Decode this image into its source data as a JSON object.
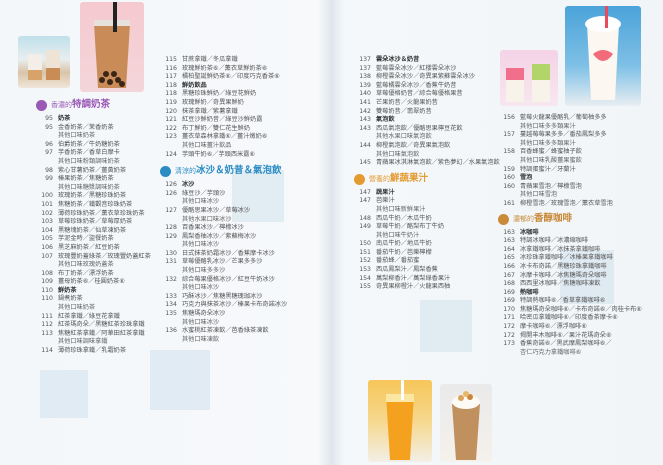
{
  "colors": {
    "tea": "#9b59b6",
    "ice": "#2b8cc4",
    "juice": "#e39a2f",
    "coffee": "#c98a3a"
  },
  "sections": {
    "tea": {
      "pre": "香濃的",
      "big": "特調奶茶"
    },
    "ice": {
      "pre": "清涼的",
      "big": "冰沙＆奶昔＆氣泡飲"
    },
    "juice": {
      "pre": "營養的",
      "big": "鮮蔬果汁"
    },
    "coffee": {
      "pre": "濃郁的",
      "big": "香醇咖啡"
    }
  },
  "col1": [
    [
      "95",
      "奶茶",
      "cat"
    ],
    [
      "95",
      "金香奶茶／茉香奶茶",
      ""
    ],
    [
      "",
      "其他口味奶茶",
      "sub"
    ],
    [
      "96",
      "伯爵奶茶／牛奶糖奶茶",
      ""
    ],
    [
      "97",
      "芋香奶茶／香草白摩卡",
      ""
    ],
    [
      "",
      "其他口味粉類調味奶茶",
      "sub"
    ],
    [
      "98",
      "紫心甘薯奶茶／薑黃奶茶",
      ""
    ],
    [
      "99",
      "榛果奶茶／焦糖奶茶",
      ""
    ],
    [
      "",
      "其他口味糖漿調味奶茶",
      "sub"
    ],
    [
      "100",
      "玫瑰奶茶／黑糖珍珠奶茶",
      ""
    ],
    [
      "101",
      "焦糖奶茶／鐵觀音珍珠奶茶",
      ""
    ],
    [
      "102",
      "薄荷珍珠奶茶／薰衣草珍珠奶茶",
      ""
    ],
    [
      "103",
      "草莓珍珠奶茶／草莓厚奶茶",
      ""
    ],
    [
      "104",
      "黑糖塊奶茶／仙草凍奶茶",
      ""
    ],
    [
      "105",
      "芋泥金時／盜餐奶茶",
      ""
    ],
    [
      "106",
      "黑芝麻奶茶／紅豆奶茶",
      ""
    ],
    [
      "107",
      "玫瑰豐奶蓋綠茶／玫瑰豐奶蓋紅茶",
      ""
    ],
    [
      "",
      "其他口味玫瑰奶蓋茶",
      "sub"
    ],
    [
      "108",
      "布丁奶茶／漂浮奶茶",
      ""
    ],
    [
      "109",
      "薑母奶茶⑥／桂圓奶茶⑥",
      ""
    ],
    [
      "110",
      "鮮奶茶",
      "cat"
    ],
    [
      "110",
      "鍋煮奶茶",
      ""
    ],
    [
      "",
      "其他口味奶茶",
      "sub"
    ],
    [
      "111",
      "紅茶拿鐵／綠豆花拿鐵",
      ""
    ],
    [
      "112",
      "紅茶瑪奇朵／黑糖紅茶珍珠拿鐵",
      ""
    ],
    [
      "113",
      "焦糖紅茶拿鐵／阿華田紅茶拿鐵",
      ""
    ],
    [
      "",
      "其他口味調味拿鐵",
      "sub"
    ],
    [
      "114",
      "薄荷珍珠拿鐵／乳霜奶茶",
      ""
    ]
  ],
  "col2": [
    [
      "115",
      "甘蔗拿鐵／冬瓜拿鐵",
      ""
    ],
    [
      "116",
      "玫瑰鮮奶茶⑥／薰衣草鮮奶茶⑥",
      ""
    ],
    [
      "117",
      "橘柏聖誕鮮奶茶⑥／印度巧克香茶⑥",
      ""
    ],
    [
      "118",
      "鮮奶飲品",
      "cat"
    ],
    [
      "118",
      "黑糖珍珠鮮奶／綠豆花鮮奶",
      ""
    ],
    [
      "119",
      "玫瑰鮮奶／奇異果鮮奶",
      ""
    ],
    [
      "120",
      "抹茶拿鐵／紫薯拿鐵",
      ""
    ],
    [
      "121",
      "紅豆沙鮮奶昔／綠豆沙鮮奶露",
      ""
    ],
    [
      "122",
      "布丁鮮奶／雙仁花生鮮奶",
      ""
    ],
    [
      "123",
      "薑衣草森林拿鐵⑥／薑汁燉奶⑥",
      ""
    ],
    [
      "",
      "其他口味薑汁飲品",
      "sub"
    ],
    [
      "124",
      "芋頭牛奶⑥／芋頭西米露⑥",
      ""
    ]
  ],
  "col2b": [
    [
      "126",
      "冰沙",
      "cat"
    ],
    [
      "126",
      "綠豆沙／芋頭沙",
      ""
    ],
    [
      "",
      "其他口味冰沙",
      "sub"
    ],
    [
      "127",
      "優酪思果冰沙／草莓冰沙",
      ""
    ],
    [
      "",
      "其他水果口味冰沙",
      "sub"
    ],
    [
      "128",
      "百香果冰沙／檸檬冰沙",
      ""
    ],
    [
      "129",
      "鳳梨香柚冰沙／紫蘇梅冰沙",
      ""
    ],
    [
      "",
      "其他口味冰沙",
      "sub"
    ],
    [
      "130",
      "日式抹茶奶霜冰沙／香蕉摩卡冰沙",
      ""
    ],
    [
      "131",
      "草莓優酪乳冰沙／芒果多多沙",
      ""
    ],
    [
      "",
      "其他口味多多沙",
      "sub"
    ],
    [
      "132",
      "綜合莓果優格冰沙／紅豆牛奶冰沙",
      ""
    ],
    [
      "",
      "其他口味冰沙",
      "sub"
    ],
    [
      "133",
      "巧酥冰沙／焦糖黑糖瑰珈冰沙",
      ""
    ],
    [
      "134",
      "巧克力與抹茶冰沙／榛果卡布奇諾冰沙",
      ""
    ],
    [
      "135",
      "焦糖瑪奇朵冰沙",
      ""
    ],
    [
      "",
      "其他口味冰沙",
      "sub"
    ],
    [
      "136",
      "水蜜桃紅茶凍飲／芭香綠茶凍飲",
      ""
    ],
    [
      "",
      "其他口味凍飲",
      "sub"
    ]
  ],
  "col3": [
    [
      "137",
      "雲朵冰沙＆奶昔",
      "cat"
    ],
    [
      "137",
      "藍莓雲朵冰沙／紅櫻雲朵冰沙",
      ""
    ],
    [
      "138",
      "柳橙雲朵冰沙／奇異果紫蘇雲朵冰沙",
      ""
    ],
    [
      "139",
      "藍莓橘雲朵冰沙／香蕉牛奶昔",
      ""
    ],
    [
      "140",
      "草莓優格奶昔／綜合莓優格果昔",
      ""
    ],
    [
      "141",
      "芒果奶昔／火龍果奶昔",
      ""
    ],
    [
      "142",
      "雙莓奶昔／翡翠奶昔",
      ""
    ],
    [
      "143",
      "氣泡飲",
      "cat"
    ],
    [
      "143",
      "西瓜氣泡飲／優酪思果檸豆花飲",
      ""
    ],
    [
      "",
      "其他水果口味氣泡飲",
      "sub"
    ],
    [
      "144",
      "柳橙氣泡飲／奇異果氣泡飲",
      ""
    ],
    [
      "",
      "其他口味氣泡飲",
      "sub"
    ],
    [
      "145",
      "青蘋果冰淇淋氣泡飲／紫色夢幻／水果氣泡飲",
      ""
    ]
  ],
  "col3b": [
    [
      "147",
      "蔬果汁",
      "cat"
    ],
    [
      "147",
      "芭樂汁",
      ""
    ],
    [
      "",
      "其他口味新鮮果汁",
      "sub"
    ],
    [
      "148",
      "西瓜牛奶／木瓜牛奶",
      ""
    ],
    [
      "149",
      "草莓牛奶／酪梨布丁牛奶",
      ""
    ],
    [
      "",
      "其他口味牛奶汁",
      "sub"
    ],
    [
      "150",
      "南瓜牛奶／地瓜牛奶",
      ""
    ],
    [
      "151",
      "番茄牛奶／芭樂檸檬",
      ""
    ],
    [
      "152",
      "番茄蜂／番茄蜜",
      ""
    ],
    [
      "153",
      "西瓜鳳梨汁／鳳梨香蕉",
      ""
    ],
    [
      "154",
      "萬梨柳香汁／萬梨綠香果汁",
      ""
    ],
    [
      "155",
      "奇異果柳橙汁／火龍果西柚",
      ""
    ]
  ],
  "col4": [
    [
      "156",
      "藍莓火龍果優酪乳／葡萄柚多多",
      ""
    ],
    [
      "",
      "其他口味多多類果汁",
      "sub"
    ],
    [
      "157",
      "蔓越莓莓果多多／番茄鳳梨多多",
      ""
    ],
    [
      "",
      "其他口味多多類果汁",
      "sub"
    ],
    [
      "158",
      "百香蜂蜜／蜂蜜柚子飲",
      ""
    ],
    [
      "",
      "其他口味乳酸薑果蜜飲",
      "sub"
    ],
    [
      "159",
      "特調蛋蜜汁／牙蘭汁",
      ""
    ],
    [
      "160",
      "雪泡",
      "cat"
    ],
    [
      "160",
      "青蘋果雪泡／檸檬雪泡",
      ""
    ],
    [
      "",
      "其他口味雪泡",
      "sub"
    ],
    [
      "161",
      "柳橙雪泡／玫瑰雪泡／薰衣草雪泡",
      ""
    ]
  ],
  "col4b": [
    [
      "163",
      "冰咖啡",
      "cat"
    ],
    [
      "163",
      "特調冰咖啡／冰濃縮咖啡",
      ""
    ],
    [
      "164",
      "冰拿鐵咖啡／冰抹茶拿鐵咖啡",
      ""
    ],
    [
      "165",
      "冰珍珠拿鐵咖啡／冰榛果拿鐵咖啡",
      ""
    ],
    [
      "166",
      "冰卡布奇諾／黑糖珍珠拿鐵咖啡",
      ""
    ],
    [
      "167",
      "冰摩卡咖啡／冰焦糖瑪奇朵咖啡",
      ""
    ],
    [
      "168",
      "西西里冰咖啡／焦糖咖啡凍飲",
      ""
    ],
    [
      "169",
      "熱咖啡",
      "cat"
    ],
    [
      "169",
      "特調熱咖啡⑥／香草拿鐵咖啡⑥",
      ""
    ],
    [
      "170",
      "焦糖瑪奇朵咖啡⑥／卡布奇諾⑥／肉桂卡布⑥",
      ""
    ],
    [
      "171",
      "哈密瓜拿鐵咖啡⑥／印度香茶摩卡⑥",
      ""
    ],
    [
      "172",
      "摩卡咖啡⑥／漂浮咖啡⑥",
      ""
    ],
    [
      "172",
      "揭開丰木咖啡⑥／果汁花瑪奇朵⑥",
      ""
    ],
    [
      "173",
      "香蕉奇諾⑥／黑武摩鳳梨咖啡⑥／",
      ""
    ],
    [
      "",
      "杏仁巧克力拿鐵咖啡⑥",
      "sub"
    ]
  ],
  "page_numbers": {
    "left": "2",
    "right": "3"
  }
}
